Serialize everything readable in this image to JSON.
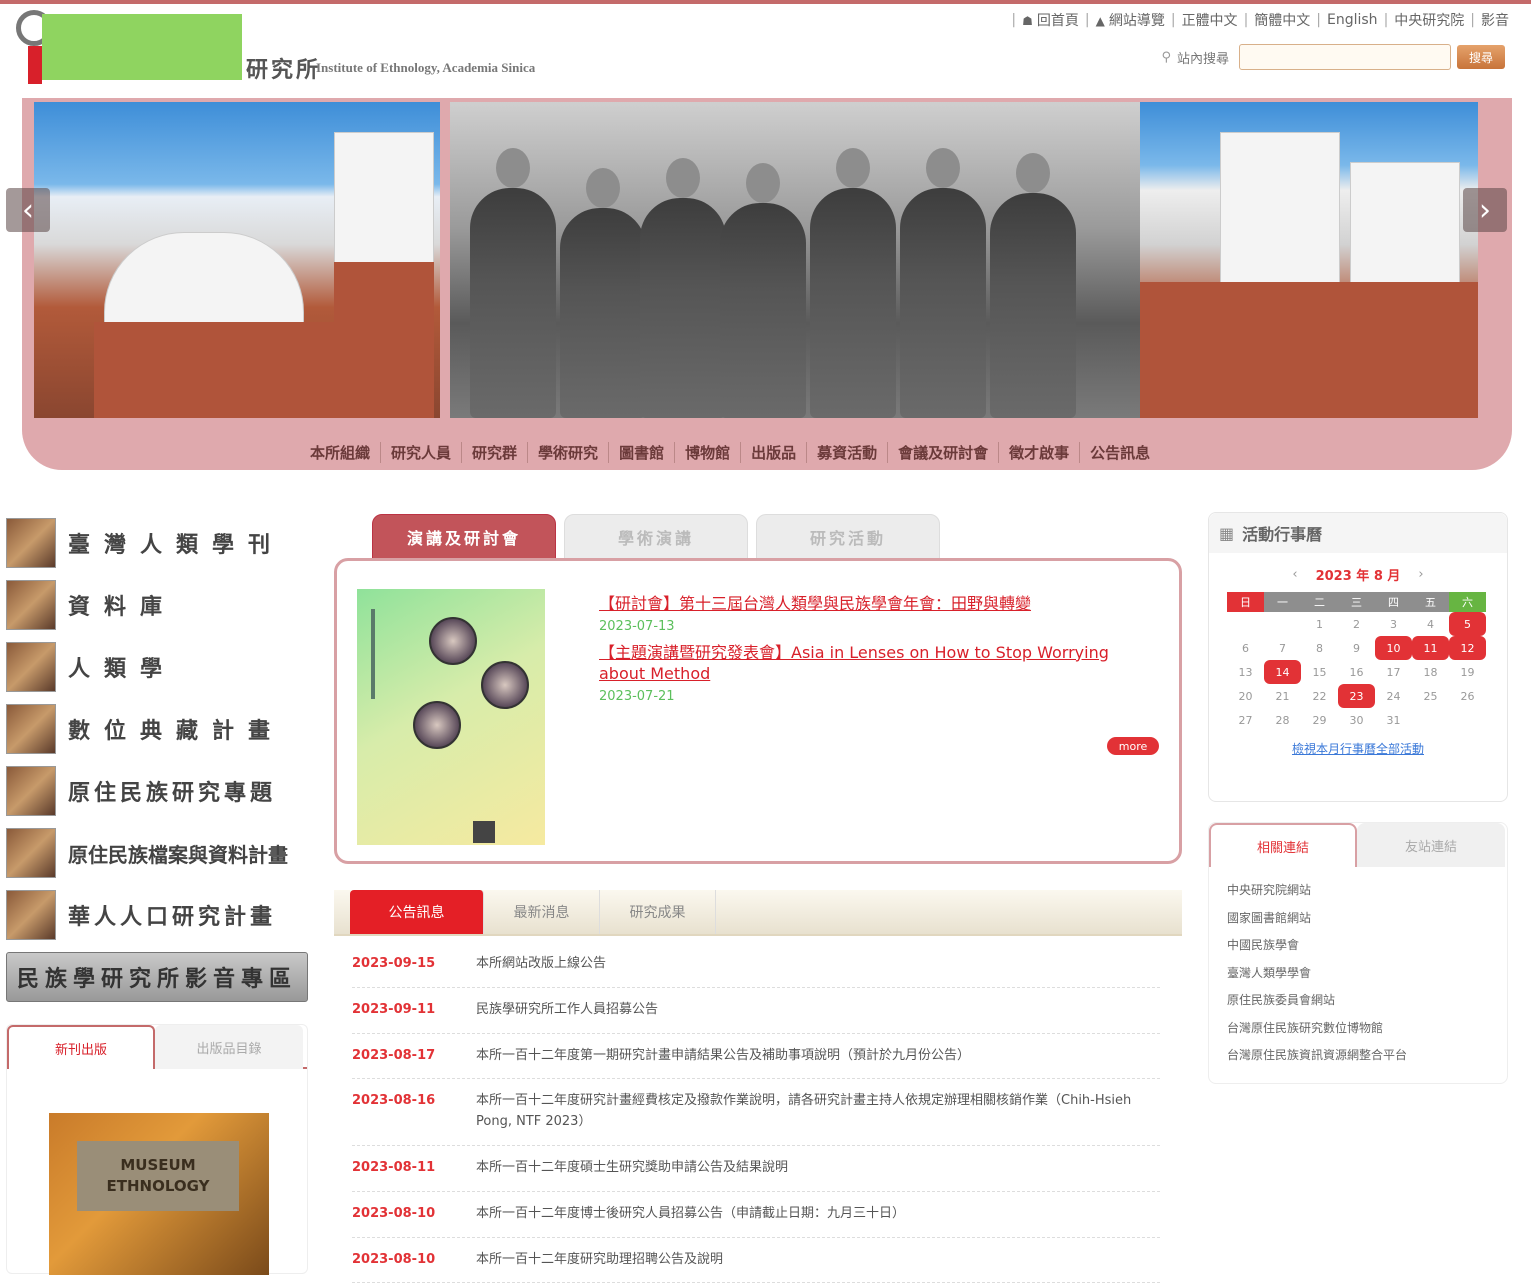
{
  "header": {
    "site_name_cn": "研究所",
    "site_name_en": "Institute of Ethnology, Academia Sinica",
    "top_nav": [
      {
        "icon": "home-icon",
        "label": "回首頁"
      },
      {
        "icon": "sitemap-icon",
        "label": "網站導覽"
      },
      {
        "label": "正體中文"
      },
      {
        "label": "簡體中文"
      },
      {
        "label": "English"
      },
      {
        "label": "中央研究院"
      },
      {
        "label": "影音"
      }
    ],
    "search": {
      "label": "站內搜尋",
      "placeholder": "",
      "button": "搜尋"
    }
  },
  "main_nav": [
    "本所組織",
    "研究人員",
    "研究群",
    "學術研究",
    "圖書館",
    "博物館",
    "出版品",
    "募資活動",
    "會議及研討會",
    "徵才啟事",
    "公告訊息"
  ],
  "left_panel": {
    "items": [
      {
        "label": "臺灣人類學刊"
      },
      {
        "label": "資料庫"
      },
      {
        "label": "人類學"
      },
      {
        "label": "數位典藏計畫"
      },
      {
        "label": "原住民族研究專題"
      },
      {
        "label": "原住民族檔案與資料計畫"
      },
      {
        "label": "華人人口研究計畫"
      }
    ],
    "banner_label": "民族學研究所影音專區",
    "tabs": [
      {
        "label": "新刊出版"
      },
      {
        "label": "出版品目錄"
      }
    ],
    "book": {
      "line1": "MUSEUM",
      "line2": "ETHNOLOGY"
    }
  },
  "center": {
    "tabs": [
      {
        "label": "演講及研討會"
      },
      {
        "label": "學術演講"
      },
      {
        "label": "研究活動"
      }
    ],
    "announcements": [
      {
        "title": "【研討會】第十三屆台灣人類學與民族學會年會：田野與轉變",
        "date": "2023-07-13"
      },
      {
        "title": "【主題演講暨研究發表會】Asia in Lenses on How to Stop Worrying about Method",
        "date": "2023-07-21"
      }
    ],
    "more_label": "more",
    "news_tabs": [
      {
        "label": "公告訊息"
      },
      {
        "label": "最新消息"
      },
      {
        "label": "研究成果"
      }
    ],
    "news": [
      {
        "date": "2023-09-15",
        "title": "本所網站改版上線公告"
      },
      {
        "date": "2023-09-11",
        "title": "民族學研究所工作人員招募公告"
      },
      {
        "date": "2023-08-17",
        "title": "本所一百十二年度第一期研究計畫申請結果公告及補助事項說明（預計於九月份公告）"
      },
      {
        "date": "2023-08-16",
        "title": "本所一百十二年度研究計畫經費核定及撥款作業說明，請各研究計畫主持人依規定辦理相關核銷作業（Chih-Hsieh Pong, NTF 2023）"
      },
      {
        "date": "2023-08-11",
        "title": "本所一百十二年度碩士生研究獎助申請公告及結果說明"
      },
      {
        "date": "2023-08-10",
        "title": "本所一百十二年度博士後研究人員招募公告（申請截止日期：九月三十日）"
      },
      {
        "date": "2023-08-10",
        "title": "本所一百十二年度研究助理招聘公告及說明"
      }
    ]
  },
  "calendar": {
    "title": "活動行事曆",
    "prev_label": "‹",
    "year_month": "2023 年 8 月",
    "next_label": "›",
    "weekdays": [
      "日",
      "一",
      "二",
      "三",
      "四",
      "五",
      "六"
    ],
    "days": [
      {
        "d": ""
      },
      {
        "d": ""
      },
      {
        "d": "1"
      },
      {
        "d": "2"
      },
      {
        "d": "3"
      },
      {
        "d": "4"
      },
      {
        "d": "5",
        "ev": true
      },
      {
        "d": "6"
      },
      {
        "d": "7"
      },
      {
        "d": "8"
      },
      {
        "d": "9"
      },
      {
        "d": "10",
        "ev": true
      },
      {
        "d": "11",
        "ev": true
      },
      {
        "d": "12",
        "ev": true
      },
      {
        "d": "13"
      },
      {
        "d": "14",
        "ev": true
      },
      {
        "d": "15"
      },
      {
        "d": "16"
      },
      {
        "d": "17"
      },
      {
        "d": "18"
      },
      {
        "d": "19"
      },
      {
        "d": "20"
      },
      {
        "d": "21"
      },
      {
        "d": "22"
      },
      {
        "d": "23",
        "ev": true
      },
      {
        "d": "24"
      },
      {
        "d": "25"
      },
      {
        "d": "26"
      },
      {
        "d": "27"
      },
      {
        "d": "28"
      },
      {
        "d": "29"
      },
      {
        "d": "30"
      },
      {
        "d": "31"
      },
      {
        "d": ""
      },
      {
        "d": ""
      }
    ],
    "link": "檢視本月行事曆全部活動"
  },
  "right_links": {
    "tabs": [
      {
        "label": "相關連結"
      },
      {
        "label": "友站連結"
      }
    ],
    "items": [
      "中央研究院網站",
      "國家圖書館網站",
      "中國民族學會",
      "臺灣人類學學會",
      "原住民族委員會網站",
      "台灣原住民族研究數位博物館",
      "台灣原住民族資訊資源網整合平台"
    ]
  },
  "colors": {
    "accent_red": "#e23236",
    "banner_pink": "#dfa9ad",
    "date_green": "#5cbf5c"
  }
}
